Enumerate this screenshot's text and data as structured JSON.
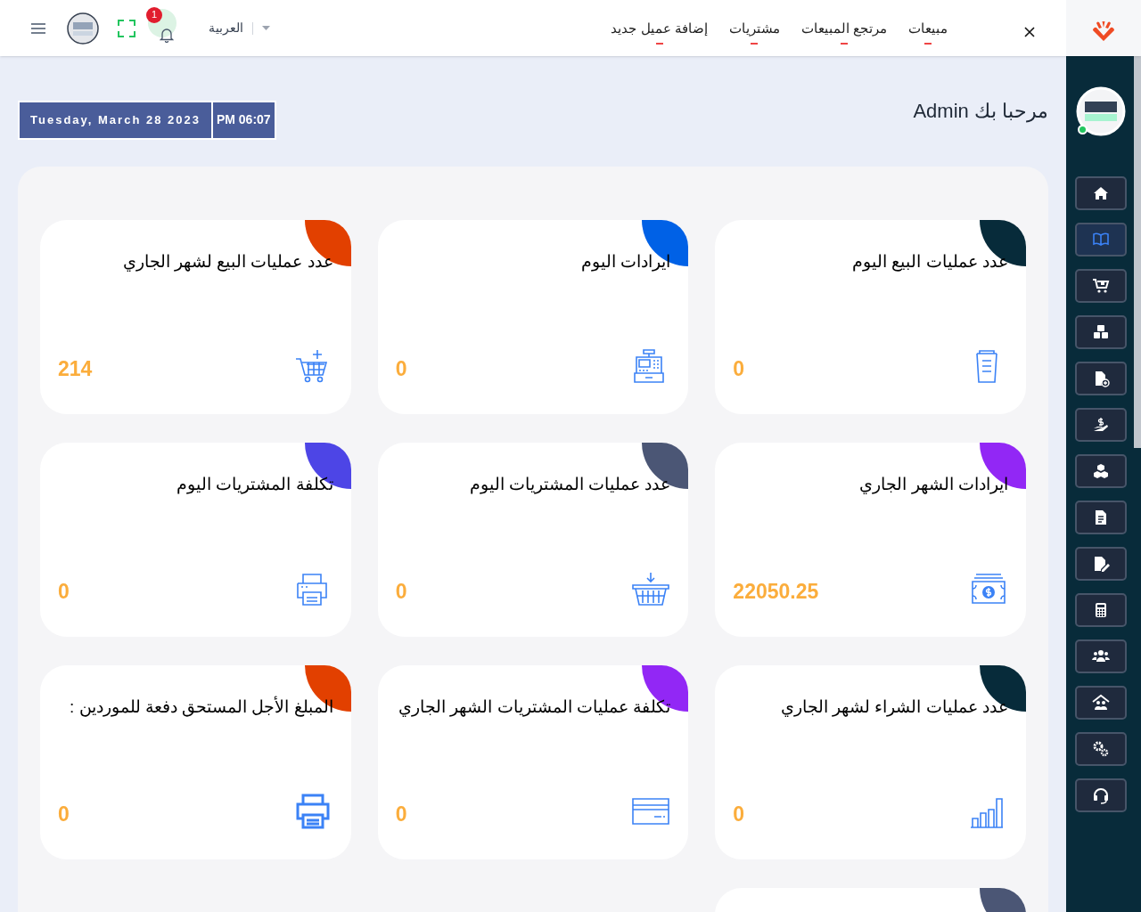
{
  "header": {
    "notifications": "1",
    "language": "العربية",
    "nav": [
      {
        "label": "مبيعات"
      },
      {
        "label": "مرتجع المبيعات"
      },
      {
        "label": "مشتريات"
      },
      {
        "label": "إضافة عميل جديد"
      }
    ]
  },
  "welcome": "مرحبا بك Admin",
  "date": "Tuesday, March 28 2023",
  "time": "PM 06:07",
  "sidebar": {
    "items": [
      {
        "selected": false
      },
      {
        "selected": true
      },
      {
        "selected": false
      },
      {
        "selected": false
      },
      {
        "selected": false
      },
      {
        "selected": false
      },
      {
        "selected": false
      },
      {
        "selected": false
      },
      {
        "selected": false
      },
      {
        "selected": false
      },
      {
        "selected": false
      },
      {
        "selected": false
      },
      {
        "selected": false
      },
      {
        "selected": false
      }
    ]
  },
  "cards": [
    {
      "title": "عدد عمليات البيع اليوم",
      "value": "0",
      "color": "#072b3a"
    },
    {
      "title": "ايرادات اليوم",
      "value": "0",
      "color": "#0061e6"
    },
    {
      "title": "عدد عمليات البيع لشهر الجاري",
      "value": "214",
      "color": "#e24000"
    },
    {
      "title": "ايرادات الشهر الجاري",
      "value": "22050.25",
      "color": "#9227f5"
    },
    {
      "title": "عدد عمليات المشتريات اليوم",
      "value": "0",
      "color": "#4b5675"
    },
    {
      "title": "تكلفة المشتريات اليوم",
      "value": "0",
      "color": "#4d45e6"
    },
    {
      "title": "عدد عمليات الشراء لشهر الجاري",
      "value": "0",
      "color": "#072b3a"
    },
    {
      "title": "تكلفة عمليات المشتريات الشهر الجاري",
      "value": "0",
      "color": "#9227f5"
    },
    {
      "title": "المبلغ الأجل المستحق دفعة للموردين :",
      "value": "0",
      "color": "#e24000"
    },
    {
      "color": "#4b5675"
    }
  ]
}
